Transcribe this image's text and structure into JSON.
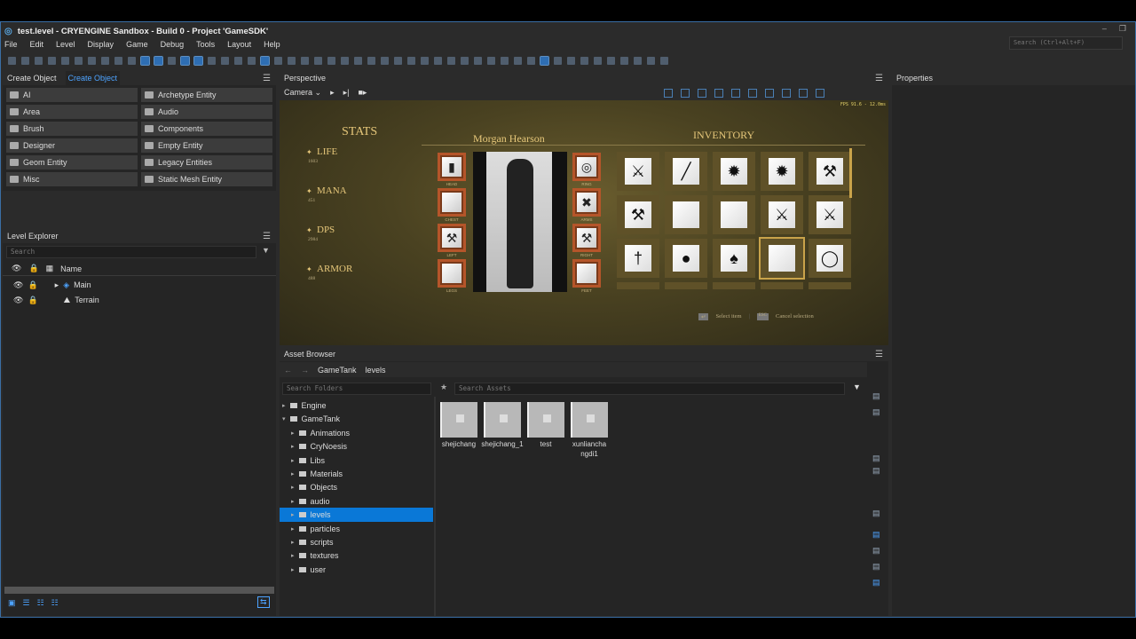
{
  "window": {
    "title": "test.level - CRYENGINE Sandbox - Build 0 - Project 'GameSDK'",
    "search_placeholder": "Search (Ctrl+Alt+F)"
  },
  "menu": [
    "File",
    "Edit",
    "Level",
    "Display",
    "Game",
    "Debug",
    "Tools",
    "Layout",
    "Help"
  ],
  "create_object": {
    "tabs": [
      "Create Object",
      "Create Object"
    ],
    "items": [
      "AI",
      "Archetype Entity",
      "Area",
      "Audio",
      "Brush",
      "Components",
      "Designer",
      "Empty Entity",
      "Geom Entity",
      "Legacy Entities",
      "Misc",
      "Static Mesh Entity"
    ]
  },
  "level_explorer": {
    "title": "Level Explorer",
    "search_placeholder": "Search",
    "column": "Name",
    "rows": [
      "Main",
      "Terrain"
    ]
  },
  "perspective": {
    "title": "Perspective",
    "camera": "Camera",
    "fps": "FPS 91.6 - 12.0ms"
  },
  "game": {
    "stats_title": "STATS",
    "character": "Morgan Hearson",
    "inventory_title": "INVENTORY",
    "stats": [
      {
        "label": "LIFE",
        "value": "1603"
      },
      {
        "label": "MANA",
        "value": "451"
      },
      {
        "label": "DPS",
        "value": "2984"
      },
      {
        "label": "ARMOR",
        "value": "488"
      }
    ],
    "left_slots": [
      "HEAD",
      "CHEST",
      "LEFT",
      "LEGS"
    ],
    "right_slots": [
      "RING",
      "ARMS",
      "RIGHT",
      "FEET"
    ],
    "hint_select": "Select item",
    "hint_cancel_key": "ESC",
    "hint_cancel": "Cancel selection"
  },
  "properties": {
    "title": "Properties"
  },
  "asset_browser": {
    "title": "Asset Browser",
    "breadcrumb": [
      "GameTank",
      "levels"
    ],
    "folder_search": "Search Folders",
    "asset_search": "Search Assets",
    "folders": [
      {
        "name": "Engine",
        "level": 0,
        "open": false
      },
      {
        "name": "GameTank",
        "level": 0,
        "open": true
      },
      {
        "name": "Animations",
        "level": 1
      },
      {
        "name": "CryNoesis",
        "level": 1
      },
      {
        "name": "Libs",
        "level": 1
      },
      {
        "name": "Materials",
        "level": 1
      },
      {
        "name": "Objects",
        "level": 1
      },
      {
        "name": "audio",
        "level": 1
      },
      {
        "name": "levels",
        "level": 1,
        "selected": true
      },
      {
        "name": "particles",
        "level": 1
      },
      {
        "name": "scripts",
        "level": 1
      },
      {
        "name": "textures",
        "level": 1
      },
      {
        "name": "user",
        "level": 1
      }
    ],
    "assets": [
      "shejichang",
      "shejichang_1",
      "test",
      "xunliancha ngdi1"
    ]
  },
  "colors": {
    "accent": "#0a78d7",
    "frame": "#b5552a",
    "gold": "#e6c77a"
  }
}
